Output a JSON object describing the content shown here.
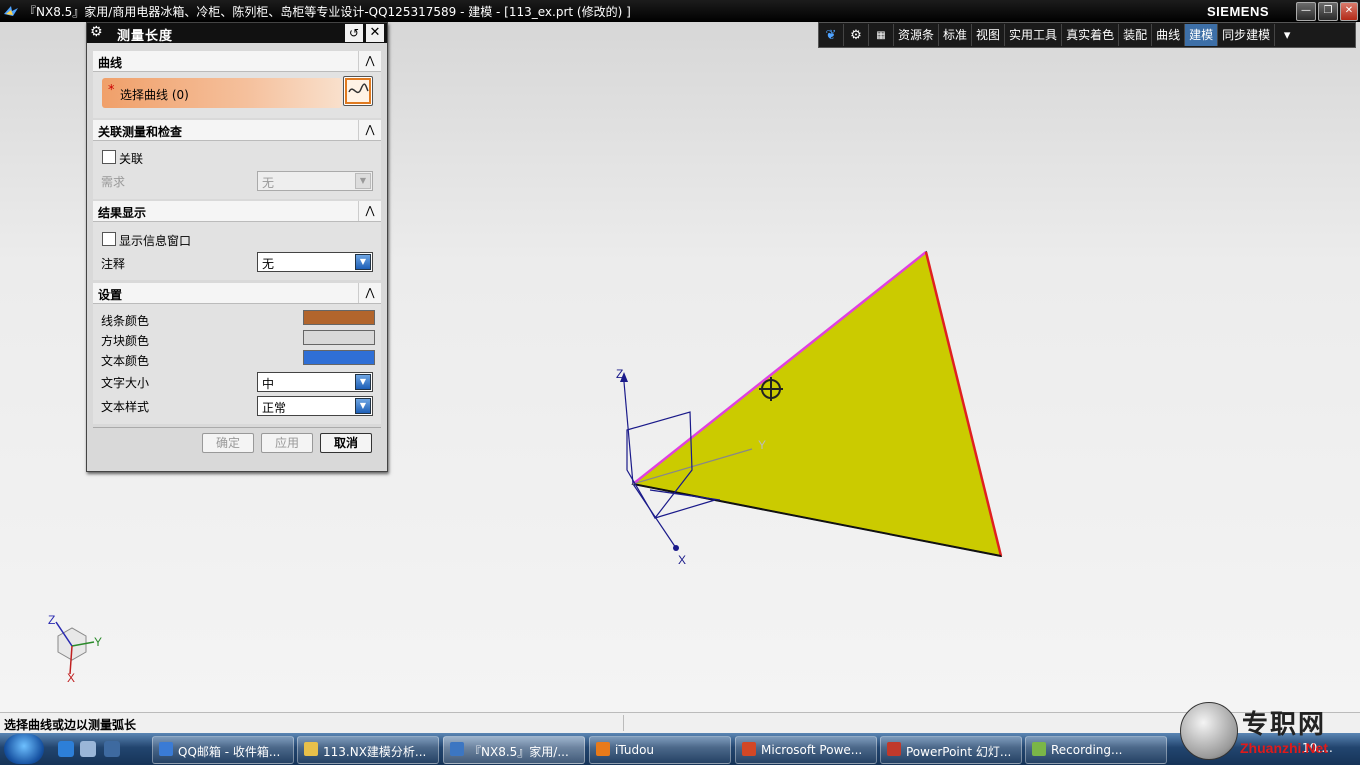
{
  "window": {
    "title": "『NX8.5』家用/商用电器冰箱、冷柜、陈列柜、岛柜等专业设计-QQ125317589 - 建模 - [113_ex.prt  (修改的) ]",
    "brand": "SIEMENS",
    "controls": {
      "minimize": "—",
      "restore": "❐",
      "close": "✕"
    }
  },
  "toolbar": {
    "icons": [
      "bird-icon",
      "gear-icon",
      "grid-icon"
    ],
    "tabs": [
      "资源条",
      "标准",
      "视图",
      "实用工具",
      "真实着色",
      "装配",
      "曲线",
      "建模",
      "同步建模"
    ],
    "active_tab": "建模",
    "menu_arrow": "▾"
  },
  "dialog": {
    "title": "测量长度",
    "reset_glyph": "↺",
    "close_glyph": "✕",
    "collapse_glyph": "⋀",
    "groups": {
      "curve": {
        "header": "曲线",
        "select_label": "选择曲线 (0)",
        "required_mark": "*"
      },
      "assoc": {
        "header": "关联测量和检查",
        "checkbox_label": "关联",
        "requirement_label": "需求",
        "requirement_value": "无"
      },
      "result": {
        "header": "结果显示",
        "checkbox_label": "显示信息窗口",
        "annotation_label": "注释",
        "annotation_value": "无"
      },
      "settings": {
        "header": "设置",
        "line_color_label": "线条颜色",
        "line_color": "#b2652c",
        "block_color_label": "方块颜色",
        "block_color": "#d8d8d8",
        "text_color_label": "文本颜色",
        "text_color": "#2f6fd6",
        "text_size_label": "文字大小",
        "text_size_value": "中",
        "text_style_label": "文本样式",
        "text_style_value": "正常"
      }
    },
    "buttons": {
      "ok": "确定",
      "apply": "应用",
      "cancel": "取消"
    }
  },
  "viewport": {
    "face_color": "#cbcb00",
    "highlight_edge_color": "#e040e0",
    "red_edge_color": "#e02020",
    "csys_labels": {
      "x": "X",
      "y": "Y",
      "z": "Z"
    },
    "triad_labels": {
      "x": "X",
      "y": "Y",
      "z": "Z"
    }
  },
  "status": {
    "message": "选择曲线或边以测量弧长"
  },
  "taskbar": {
    "items": [
      {
        "label": "QQ邮箱 - 收件箱...",
        "icon_color": "#3a7bd5"
      },
      {
        "label": "113.NX建模分析...",
        "icon_color": "#e8c04a"
      },
      {
        "label": "『NX8.5』家用/...",
        "icon_color": "#3c76c2"
      },
      {
        "label": "iTudou",
        "icon_color": "#e87a1a"
      },
      {
        "label": "Microsoft Powe...",
        "icon_color": "#d24726"
      },
      {
        "label": "PowerPoint 幻灯...",
        "icon_color": "#c0392b"
      },
      {
        "label": "Recording...",
        "icon_color": "#7ab648"
      }
    ],
    "time": "10:..."
  },
  "watermark": {
    "cn": "专职网",
    "en": "Zhuanzhi.Net"
  }
}
